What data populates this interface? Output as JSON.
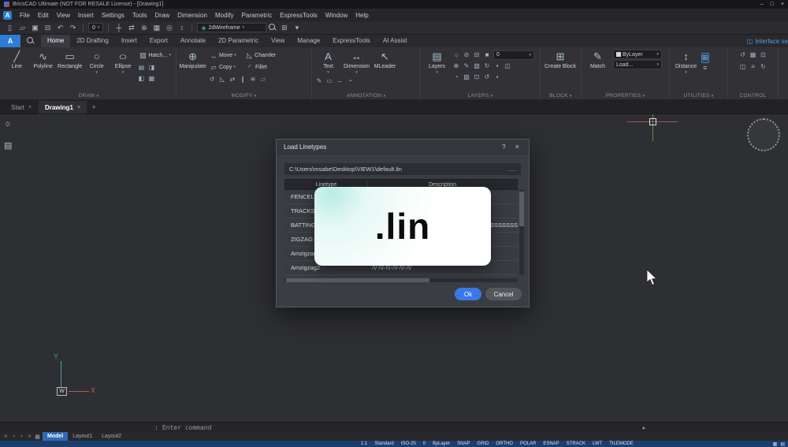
{
  "titlebar": {
    "title": "BricsCAD Ultimate (NOT FOR RESALE License) - [Drawing1]",
    "minimize": "–",
    "maximize": "□",
    "close": "×"
  },
  "menubar": {
    "items": [
      "File",
      "Edit",
      "View",
      "Insert",
      "Settings",
      "Tools",
      "Draw",
      "Dimension",
      "Modify",
      "Parametric",
      "ExpressTools",
      "Window",
      "Help"
    ]
  },
  "quickbar": {
    "left_icons": [
      "▯",
      "▱",
      "▣",
      "⊟",
      "↶",
      "↷"
    ],
    "layer_value": "0",
    "mid_icons": [
      "┼",
      "⇄",
      "⊕",
      "▦",
      "◎",
      "↕"
    ],
    "visual_style": "2dWireframe",
    "right_icons": [
      "⊞",
      "▾"
    ]
  },
  "ribbon_tabs": {
    "app_letter": "A",
    "items": [
      {
        "label": "Home",
        "active": true
      },
      {
        "label": "2D Drafting"
      },
      {
        "label": "Insert"
      },
      {
        "label": "Export"
      },
      {
        "label": "Annotate"
      },
      {
        "label": "2D Parametric"
      },
      {
        "label": "View"
      },
      {
        "label": "Manage"
      },
      {
        "label": "ExpressTools"
      },
      {
        "label": "AI Assist"
      }
    ],
    "interface_settings": "Interface se"
  },
  "icons": {
    "chevron": "▾",
    "line": "╱",
    "polyline": "∿",
    "rectangle": "▭",
    "circle": "○",
    "ellipse": "○",
    "hatch": "▨",
    "manipulate": "⊕",
    "move": "↔",
    "copy": "▱",
    "chamfer": "◺",
    "fillet": "◜",
    "text": "A",
    "dimension": "↔",
    "mleader": "↖",
    "layers": "▤",
    "create_block": "⊞",
    "match": "✎",
    "distance": "↕",
    "interface": "◫",
    "quick_measure": "⊞",
    "util_list": "≡"
  },
  "ribbon": {
    "panels": {
      "draw": {
        "label": "DRAW",
        "tools": [
          "Line",
          "Polyline",
          "Rectangle",
          "Circle",
          "Ellipse"
        ],
        "hatch": "Hatch...",
        "small1": [
          "▤",
          "◨"
        ],
        "small2": [
          "◧",
          "▦"
        ]
      },
      "modify": {
        "label": "MODIFY",
        "big": "Manipulate",
        "tools": [
          "Move",
          "Chamfer",
          "Copy",
          "Fillet"
        ],
        "small": [
          "↺",
          "◺",
          "⇄",
          "∥",
          "≋",
          "▱"
        ]
      },
      "annotation": {
        "label": "ANNOTATION",
        "tools": [
          "Text",
          "Dimension",
          "MLeader"
        ],
        "small": [
          "✎",
          "▭",
          "↔",
          "◔"
        ]
      },
      "layers": {
        "label": "LAYERS",
        "big": "Layers",
        "layer_value": "0",
        "row1": [
          "☼",
          "⊘",
          "⊟",
          "■"
        ],
        "row2": [
          "⊕",
          "✎",
          "▧",
          "↻",
          "▪",
          "◫"
        ],
        "row3": [
          "◔",
          "▧",
          "⊡",
          "↺",
          "▪"
        ]
      },
      "block": {
        "label": "BLOCK",
        "big": "Create Block"
      },
      "properties": {
        "label": "PROPERTIES",
        "big": "Match",
        "selects": [
          "ByLayer",
          "Load..."
        ]
      },
      "utilities": {
        "label": "UTILITIES",
        "big": "Distance"
      },
      "control": {
        "label": "CONTROL",
        "icons1": [
          "↺",
          "▦",
          "⊡"
        ],
        "icons2": [
          "◫",
          "≡",
          "↻"
        ]
      }
    }
  },
  "doctabs": {
    "tabs": [
      {
        "label": "Start",
        "close": "×"
      },
      {
        "label": "Drawing1",
        "close": "×",
        "active": true
      }
    ],
    "add": "+"
  },
  "canvas": {
    "side_icons": [
      "☼",
      "▤"
    ],
    "ucs": {
      "x": "X",
      "y": "Y",
      "w": "W"
    }
  },
  "dialog": {
    "title": "Load Linetypes",
    "help": "?",
    "close": "×",
    "path": "C:\\Users\\msabe\\Desktop\\VIEW1\\default.lin",
    "browse": "...",
    "columns": [
      "Linetype",
      "Description"
    ],
    "rows": [
      {
        "name": "FENCELINE2",
        "desc": ""
      },
      {
        "name": "TRACKS",
        "desc": ""
      },
      {
        "name": "BATTING",
        "desc": "SSSSSSSSSSSSSSSSSSSSSSSSSSSSSSSSSSSSSSSS"
      },
      {
        "name": "ZIGZAG",
        "desc": ""
      },
      {
        "name": "Amzigzag",
        "desc": ""
      },
      {
        "name": "Amzigzag2",
        "desc": "/\\/-/\\/-/\\/-/\\/-/\\/-/\\/"
      }
    ],
    "overlay_text": ".lin",
    "ok": "Ok",
    "cancel": "Cancel"
  },
  "commandbar": {
    "prompt": ":",
    "text": "Enter command",
    "expand": "▲"
  },
  "layoutbar": {
    "nav": [
      "«",
      "‹",
      "›",
      "»",
      "▦"
    ],
    "tabs": [
      {
        "label": "Model",
        "active": true
      },
      {
        "label": "Layout1"
      },
      {
        "label": "Layout2"
      }
    ]
  },
  "statusbar": {
    "items": [
      "1:1",
      "Standard",
      "ISO-25",
      "0",
      "ByLayer",
      "SNAP",
      "GRID",
      "ORTHO",
      "POLAR",
      "ESNAP",
      "STRACK",
      "LWT",
      "TILEMODE"
    ],
    "right_icons": [
      "▦",
      "▤"
    ]
  }
}
